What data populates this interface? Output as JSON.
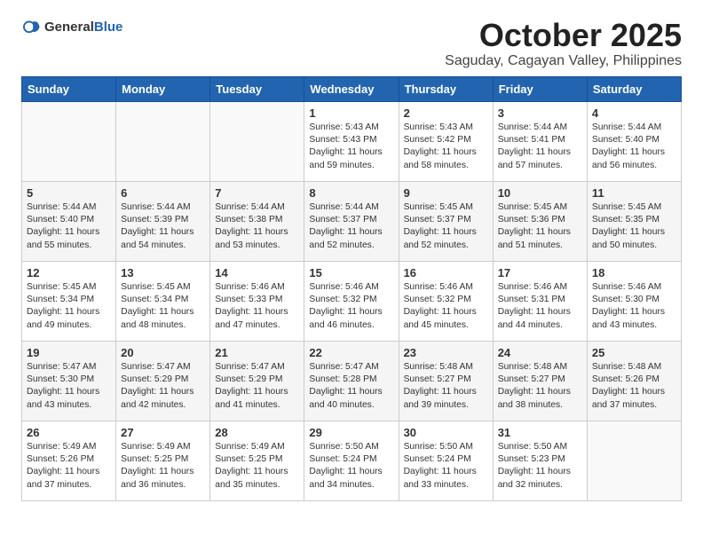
{
  "header": {
    "logo_general": "General",
    "logo_blue": "Blue",
    "month": "October 2025",
    "location": "Saguday, Cagayan Valley, Philippines"
  },
  "weekdays": [
    "Sunday",
    "Monday",
    "Tuesday",
    "Wednesday",
    "Thursday",
    "Friday",
    "Saturday"
  ],
  "weeks": [
    [
      {
        "day": "",
        "text": ""
      },
      {
        "day": "",
        "text": ""
      },
      {
        "day": "",
        "text": ""
      },
      {
        "day": "1",
        "text": "Sunrise: 5:43 AM\nSunset: 5:43 PM\nDaylight: 11 hours\nand 59 minutes."
      },
      {
        "day": "2",
        "text": "Sunrise: 5:43 AM\nSunset: 5:42 PM\nDaylight: 11 hours\nand 58 minutes."
      },
      {
        "day": "3",
        "text": "Sunrise: 5:44 AM\nSunset: 5:41 PM\nDaylight: 11 hours\nand 57 minutes."
      },
      {
        "day": "4",
        "text": "Sunrise: 5:44 AM\nSunset: 5:40 PM\nDaylight: 11 hours\nand 56 minutes."
      }
    ],
    [
      {
        "day": "5",
        "text": "Sunrise: 5:44 AM\nSunset: 5:40 PM\nDaylight: 11 hours\nand 55 minutes."
      },
      {
        "day": "6",
        "text": "Sunrise: 5:44 AM\nSunset: 5:39 PM\nDaylight: 11 hours\nand 54 minutes."
      },
      {
        "day": "7",
        "text": "Sunrise: 5:44 AM\nSunset: 5:38 PM\nDaylight: 11 hours\nand 53 minutes."
      },
      {
        "day": "8",
        "text": "Sunrise: 5:44 AM\nSunset: 5:37 PM\nDaylight: 11 hours\nand 52 minutes."
      },
      {
        "day": "9",
        "text": "Sunrise: 5:45 AM\nSunset: 5:37 PM\nDaylight: 11 hours\nand 52 minutes."
      },
      {
        "day": "10",
        "text": "Sunrise: 5:45 AM\nSunset: 5:36 PM\nDaylight: 11 hours\nand 51 minutes."
      },
      {
        "day": "11",
        "text": "Sunrise: 5:45 AM\nSunset: 5:35 PM\nDaylight: 11 hours\nand 50 minutes."
      }
    ],
    [
      {
        "day": "12",
        "text": "Sunrise: 5:45 AM\nSunset: 5:34 PM\nDaylight: 11 hours\nand 49 minutes."
      },
      {
        "day": "13",
        "text": "Sunrise: 5:45 AM\nSunset: 5:34 PM\nDaylight: 11 hours\nand 48 minutes."
      },
      {
        "day": "14",
        "text": "Sunrise: 5:46 AM\nSunset: 5:33 PM\nDaylight: 11 hours\nand 47 minutes."
      },
      {
        "day": "15",
        "text": "Sunrise: 5:46 AM\nSunset: 5:32 PM\nDaylight: 11 hours\nand 46 minutes."
      },
      {
        "day": "16",
        "text": "Sunrise: 5:46 AM\nSunset: 5:32 PM\nDaylight: 11 hours\nand 45 minutes."
      },
      {
        "day": "17",
        "text": "Sunrise: 5:46 AM\nSunset: 5:31 PM\nDaylight: 11 hours\nand 44 minutes."
      },
      {
        "day": "18",
        "text": "Sunrise: 5:46 AM\nSunset: 5:30 PM\nDaylight: 11 hours\nand 43 minutes."
      }
    ],
    [
      {
        "day": "19",
        "text": "Sunrise: 5:47 AM\nSunset: 5:30 PM\nDaylight: 11 hours\nand 43 minutes."
      },
      {
        "day": "20",
        "text": "Sunrise: 5:47 AM\nSunset: 5:29 PM\nDaylight: 11 hours\nand 42 minutes."
      },
      {
        "day": "21",
        "text": "Sunrise: 5:47 AM\nSunset: 5:29 PM\nDaylight: 11 hours\nand 41 minutes."
      },
      {
        "day": "22",
        "text": "Sunrise: 5:47 AM\nSunset: 5:28 PM\nDaylight: 11 hours\nand 40 minutes."
      },
      {
        "day": "23",
        "text": "Sunrise: 5:48 AM\nSunset: 5:27 PM\nDaylight: 11 hours\nand 39 minutes."
      },
      {
        "day": "24",
        "text": "Sunrise: 5:48 AM\nSunset: 5:27 PM\nDaylight: 11 hours\nand 38 minutes."
      },
      {
        "day": "25",
        "text": "Sunrise: 5:48 AM\nSunset: 5:26 PM\nDaylight: 11 hours\nand 37 minutes."
      }
    ],
    [
      {
        "day": "26",
        "text": "Sunrise: 5:49 AM\nSunset: 5:26 PM\nDaylight: 11 hours\nand 37 minutes."
      },
      {
        "day": "27",
        "text": "Sunrise: 5:49 AM\nSunset: 5:25 PM\nDaylight: 11 hours\nand 36 minutes."
      },
      {
        "day": "28",
        "text": "Sunrise: 5:49 AM\nSunset: 5:25 PM\nDaylight: 11 hours\nand 35 minutes."
      },
      {
        "day": "29",
        "text": "Sunrise: 5:50 AM\nSunset: 5:24 PM\nDaylight: 11 hours\nand 34 minutes."
      },
      {
        "day": "30",
        "text": "Sunrise: 5:50 AM\nSunset: 5:24 PM\nDaylight: 11 hours\nand 33 minutes."
      },
      {
        "day": "31",
        "text": "Sunrise: 5:50 AM\nSunset: 5:23 PM\nDaylight: 11 hours\nand 32 minutes."
      },
      {
        "day": "",
        "text": ""
      }
    ]
  ]
}
